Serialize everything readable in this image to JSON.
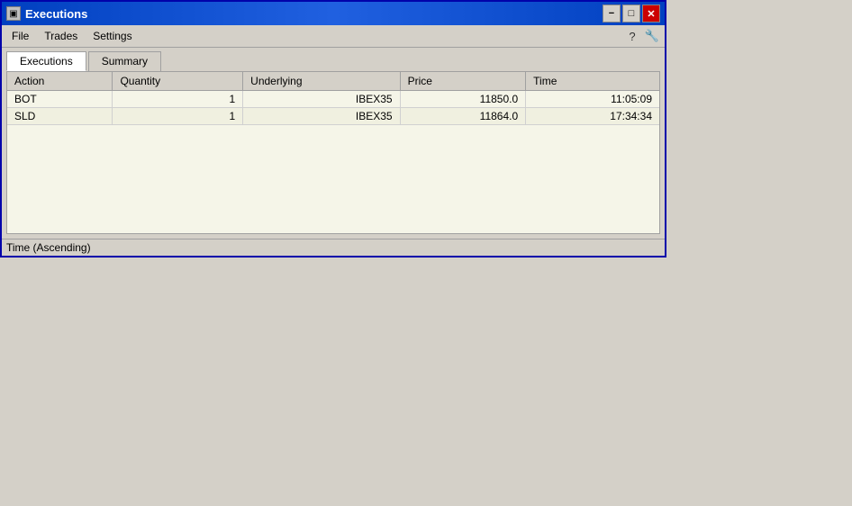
{
  "window": {
    "title": "Executions",
    "title_icon": "▣",
    "buttons": {
      "minimize": "−",
      "maximize": "□",
      "close": "✕"
    }
  },
  "menu": {
    "items": [
      "File",
      "Trades",
      "Settings"
    ],
    "help_icon": "?",
    "tool_icon": "🔧"
  },
  "tabs": [
    {
      "label": "Executions",
      "active": true
    },
    {
      "label": "Summary",
      "active": false
    }
  ],
  "table": {
    "columns": [
      "Action",
      "Quantity",
      "Underlying",
      "Price",
      "Time"
    ],
    "rows": [
      {
        "action": "BOT",
        "quantity": "1",
        "underlying": "IBEX35",
        "price": "11850.0",
        "time": "11:05:09"
      },
      {
        "action": "SLD",
        "quantity": "1",
        "underlying": "IBEX35",
        "price": "11864.0",
        "time": "17:34:34"
      }
    ]
  },
  "status_bar": {
    "text": "Time (Ascending)"
  }
}
